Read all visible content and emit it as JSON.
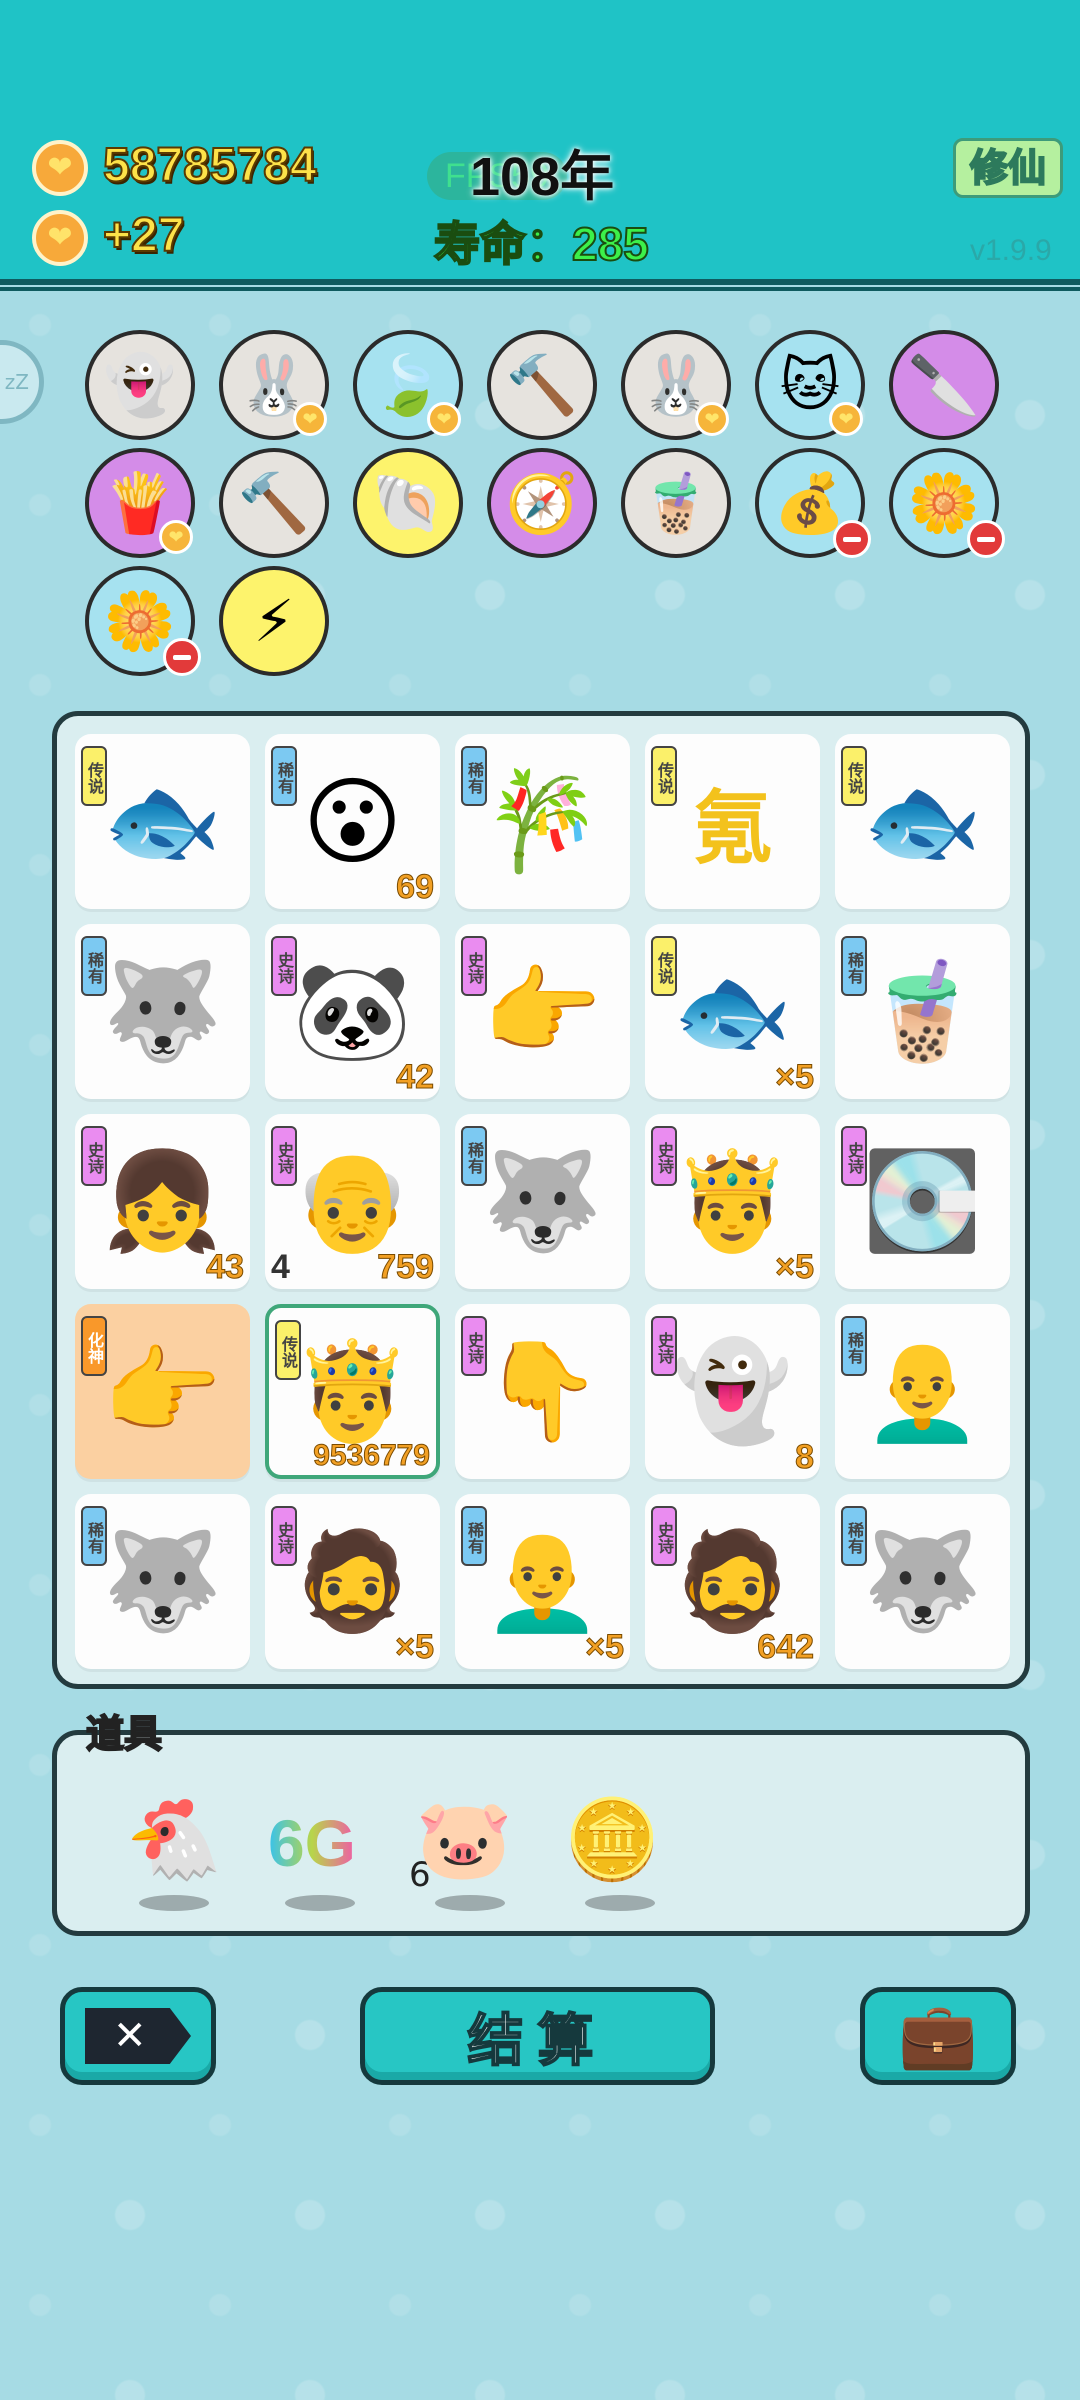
{
  "header": {
    "coins": "58785784",
    "income": "+27",
    "fps": "FPS59",
    "year": "108年",
    "life": "寿命：285",
    "cultivate_label": "修仙",
    "version": "v1.9.9",
    "sleep": "zZ"
  },
  "skills": [
    {
      "icon": "ghost-icon",
      "glyph": "👻",
      "color": "#e6e3de",
      "badge": "none"
    },
    {
      "icon": "rabbit-icon",
      "glyph": "🐰",
      "color": "#e6e3de",
      "badge": "heart"
    },
    {
      "icon": "leaf-icon",
      "glyph": "🍃",
      "color": "#a6e2f0",
      "badge": "heart"
    },
    {
      "icon": "hammer-icon",
      "glyph": "🔨",
      "color": "#e6e3de",
      "badge": "none"
    },
    {
      "icon": "rabbit-icon",
      "glyph": "🐰",
      "color": "#e6e3de",
      "badge": "heart"
    },
    {
      "icon": "cat-icon",
      "glyph": "🐱",
      "color": "#a6e2f0",
      "badge": "heart"
    },
    {
      "icon": "cleaver-icon",
      "glyph": "🔪",
      "color": "#d48ce8",
      "badge": "none"
    },
    {
      "icon": "fries-icon",
      "glyph": "🍟",
      "color": "#d48ce8",
      "badge": "heart"
    },
    {
      "icon": "hammer-icon",
      "glyph": "🔨",
      "color": "#e6e3de",
      "badge": "none"
    },
    {
      "icon": "shell-icon",
      "glyph": "🐚",
      "color": "#fdf36c",
      "badge": "none"
    },
    {
      "icon": "compass-icon",
      "glyph": "🧭",
      "color": "#d48ce8",
      "badge": "none"
    },
    {
      "icon": "milk-tea-icon",
      "glyph": "🧋",
      "color": "#e6e3de",
      "badge": "none"
    },
    {
      "icon": "money-bag-icon",
      "glyph": "💰",
      "color": "#a6e2f0",
      "badge": "minus"
    },
    {
      "icon": "flower-pot-icon",
      "glyph": "🌼",
      "color": "#a6e2f0",
      "badge": "minus"
    },
    {
      "icon": "flower-pot-icon",
      "glyph": "🌼",
      "color": "#a6e2f0",
      "badge": "minus"
    },
    {
      "icon": "lightning-icon",
      "glyph": "⚡",
      "color": "#fdf36c",
      "badge": "none"
    }
  ],
  "tags": {
    "legend": "传说",
    "rare": "稀有",
    "epic": "史诗",
    "god": "化神"
  },
  "grid": [
    {
      "icon": "koi-fish-icon",
      "glyph": "🐟",
      "tag": "legend",
      "count": ""
    },
    {
      "icon": "surprised-boy-icon",
      "glyph": "😮",
      "tag": "rare",
      "count": "69"
    },
    {
      "icon": "bamboo-icon",
      "glyph": "🎋",
      "tag": "rare",
      "count": ""
    },
    {
      "icon": "krypton-char-icon",
      "glyph": "氪",
      "tag": "legend",
      "count": ""
    },
    {
      "icon": "koi-fish-icon",
      "glyph": "🐟",
      "tag": "legend",
      "count": ""
    },
    {
      "icon": "husky-icon",
      "glyph": "🐺",
      "tag": "rare",
      "count": ""
    },
    {
      "icon": "panda-icon",
      "glyph": "🐼",
      "tag": "epic",
      "count": "42"
    },
    {
      "icon": "pointing-hand-icon",
      "glyph": "👉",
      "tag": "epic",
      "count": ""
    },
    {
      "icon": "koi-fish-icon",
      "glyph": "🐟",
      "tag": "legend",
      "count": "×5"
    },
    {
      "icon": "milk-tea-icon",
      "glyph": "🧋",
      "tag": "rare",
      "count": ""
    },
    {
      "icon": "girl-icon",
      "glyph": "👧",
      "tag": "epic",
      "count": "43"
    },
    {
      "icon": "angry-grandpa-icon",
      "glyph": "👴",
      "tag": "epic",
      "count": "759",
      "count_left": "4"
    },
    {
      "icon": "husky-icon",
      "glyph": "🐺",
      "tag": "rare",
      "count": ""
    },
    {
      "icon": "king-elder-icon",
      "glyph": "🤴",
      "tag": "epic",
      "count": "×5"
    },
    {
      "icon": "graphics-card-icon",
      "glyph": "💽",
      "tag": "epic",
      "count": ""
    },
    {
      "icon": "golden-hand-icon",
      "glyph": "👉",
      "tag": "god",
      "count": ""
    },
    {
      "icon": "golden-king-icon",
      "glyph": "🤴",
      "tag": "legend",
      "count": "9536779"
    },
    {
      "icon": "pointing-hand-icon",
      "glyph": "👇",
      "tag": "epic",
      "count": ""
    },
    {
      "icon": "ghost-icon",
      "glyph": "👻",
      "tag": "epic",
      "count": "8"
    },
    {
      "icon": "bald-man-icon",
      "glyph": "👨‍🦲",
      "tag": "rare",
      "count": ""
    },
    {
      "icon": "husky-icon",
      "glyph": "🐺",
      "tag": "rare",
      "count": ""
    },
    {
      "icon": "green-hat-elder-icon",
      "glyph": "🧔",
      "tag": "epic",
      "count": "×5"
    },
    {
      "icon": "bald-man-icon",
      "glyph": "👨‍🦲",
      "tag": "rare",
      "count": "×5"
    },
    {
      "icon": "green-hat-elder-icon",
      "glyph": "🧔",
      "tag": "epic",
      "count": "642"
    },
    {
      "icon": "husky-icon",
      "glyph": "🐺",
      "tag": "rare",
      "count": ""
    }
  ],
  "props": {
    "label": "道具",
    "items": [
      {
        "icon": "chicken-icon",
        "glyph": "🐔"
      },
      {
        "icon": "6g-icon",
        "glyph": "6G",
        "count": "6"
      },
      {
        "icon": "piggy-bank-icon",
        "glyph": "🐷"
      },
      {
        "icon": "dollar-coin-icon",
        "glyph": "🪙"
      }
    ]
  },
  "buttons": {
    "delete": "✕",
    "settle": "结算",
    "bag": "💼"
  }
}
